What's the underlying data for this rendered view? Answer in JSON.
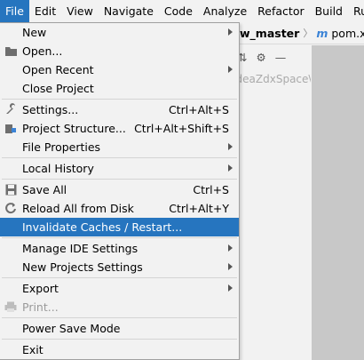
{
  "menubar": {
    "items": [
      "File",
      "Edit",
      "View",
      "Navigate",
      "Code",
      "Analyze",
      "Refactor",
      "Build",
      "Run"
    ]
  },
  "background": {
    "breadcrumb_project": "w_master",
    "breadcrumb_file": "pom.xml",
    "path_text": "IdeaZdxSpace\\"
  },
  "file_menu": {
    "new": "New",
    "open": "Open...",
    "open_recent": "Open Recent",
    "close_project": "Close Project",
    "settings": "Settings...",
    "settings_sc": "Ctrl+Alt+S",
    "project_structure": "Project Structure...",
    "project_structure_sc": "Ctrl+Alt+Shift+S",
    "file_properties": "File Properties",
    "local_history": "Local History",
    "save_all": "Save All",
    "save_all_sc": "Ctrl+S",
    "reload": "Reload All from Disk",
    "reload_sc": "Ctrl+Alt+Y",
    "invalidate": "Invalidate Caches / Restart...",
    "manage_ide": "Manage IDE Settings",
    "new_projects": "New Projects Settings",
    "export": "Export",
    "print": "Print...",
    "power_save": "Power Save Mode",
    "exit": "Exit"
  },
  "colors": {
    "highlight": "#2675bf",
    "disabled": "#9a9a9a"
  }
}
